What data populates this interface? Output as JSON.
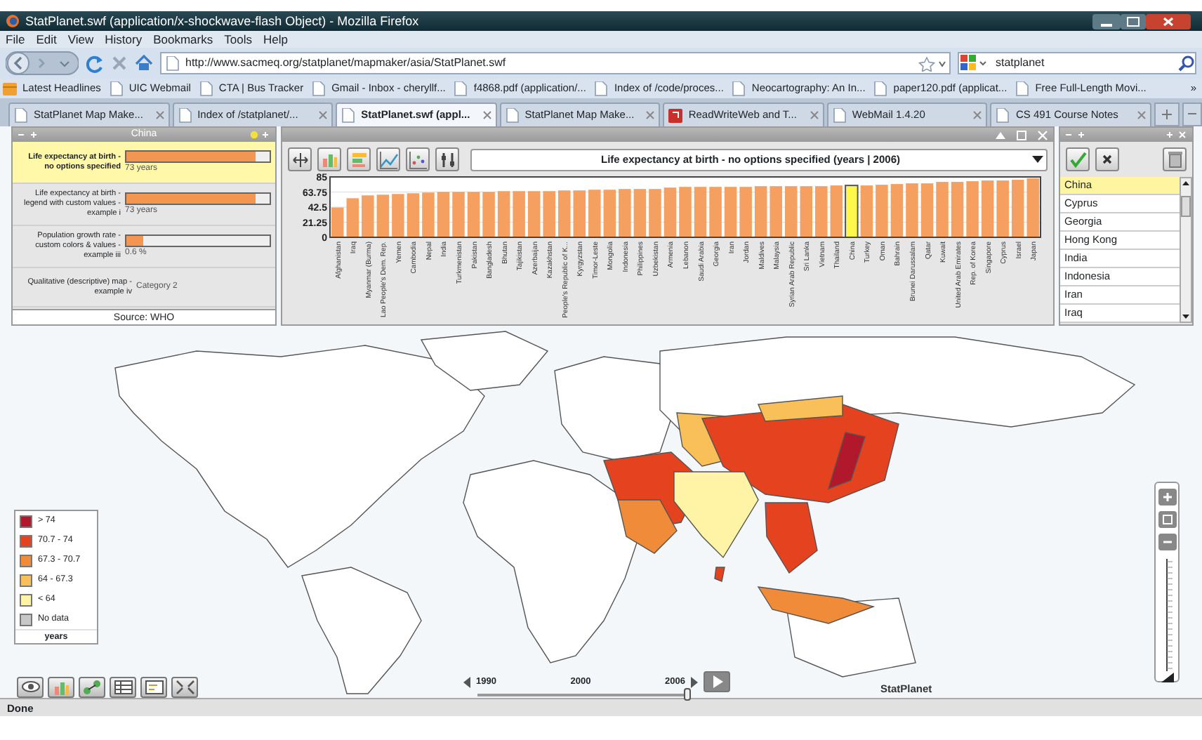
{
  "window": {
    "title": "StatPlanet.swf (application/x-shockwave-flash Object) - Mozilla Firefox"
  },
  "menu": [
    "File",
    "Edit",
    "View",
    "History",
    "Bookmarks",
    "Tools",
    "Help"
  ],
  "address_bar": {
    "url": "http://www.sacmeq.org/statplanet/mapmaker/asia/StatPlanet.swf"
  },
  "search": {
    "value": "statplanet"
  },
  "bookmarks": [
    {
      "label": "Latest Headlines",
      "kind": "feed"
    },
    {
      "label": "UIC Webmail",
      "kind": "page"
    },
    {
      "label": "CTA | Bus Tracker",
      "kind": "page"
    },
    {
      "label": "Gmail - Inbox - cheryllf...",
      "kind": "page"
    },
    {
      "label": "f4868.pdf (application/...",
      "kind": "page"
    },
    {
      "label": "Index of /code/proces...",
      "kind": "page"
    },
    {
      "label": "Neocartography: An In...",
      "kind": "page"
    },
    {
      "label": "paper120.pdf (applicat...",
      "kind": "page"
    },
    {
      "label": "Free Full-Length Movi...",
      "kind": "page"
    },
    {
      "label": "»",
      "kind": "more"
    }
  ],
  "tabs": [
    {
      "label": "StatPlanet Map Make...",
      "selected": false,
      "kind": "page"
    },
    {
      "label": "Index of /statplanet/...",
      "selected": false,
      "kind": "page"
    },
    {
      "label": "StatPlanet.swf (appl...",
      "selected": true,
      "kind": "page"
    },
    {
      "label": "StatPlanet Map Make...",
      "selected": false,
      "kind": "page"
    },
    {
      "label": "ReadWriteWeb and T...",
      "selected": false,
      "kind": "site"
    },
    {
      "label": "WebMail 1.4.20",
      "selected": false,
      "kind": "page"
    },
    {
      "label": "CS 491 Course Notes",
      "selected": false,
      "kind": "page"
    }
  ],
  "indicator_panel": {
    "title": "China",
    "items": [
      {
        "label": "Life expectancy at birth - no options specified",
        "value": "73 years",
        "kind": "bar",
        "level": 0.9,
        "selected": true
      },
      {
        "label": "Life expectancy at birth - legend with custom values - example i",
        "value": "73 years",
        "kind": "bar",
        "level": 0.9,
        "selected": false
      },
      {
        "label": "Population growth rate - custom colors & values - example iii",
        "value": "0.6 %",
        "kind": "bar",
        "level": 0.12,
        "selected": false
      },
      {
        "label": "Qualitative (descriptive) map - example iv",
        "value": "Category 2",
        "kind": "text",
        "selected": false
      }
    ],
    "source": "Source: WHO"
  },
  "chart_panel": {
    "title": "Life expectancy at birth - no options specified (years | 2006)",
    "chart_data": {
      "type": "bar",
      "grid": true,
      "ylim": [
        0,
        85
      ],
      "yticks": [
        0,
        21.25,
        42.5,
        63.75,
        85
      ],
      "categories": [
        "Afghanistan",
        "Iraq",
        "Myanmar (Burma)",
        "Lao People's Dem. Rep.",
        "Yemen",
        "Cambodia",
        "Nepal",
        "India",
        "Turkmenistan",
        "Pakistan",
        "Bangladesh",
        "Bhutan",
        "Tajikistan",
        "Azerbaijan",
        "Kazakhstan",
        "People's Republic of K...",
        "Kyrgyzstan",
        "Timor-Leste",
        "Mongolia",
        "Indonesia",
        "Philippines",
        "Uzbekistan",
        "Armenia",
        "Lebanon",
        "Saudi Arabia",
        "Georgia",
        "Iran",
        "Jordan",
        "Maldives",
        "Malaysia",
        "Syrian Arab Republic",
        "Sri Lanka",
        "Vietnam",
        "Thailand",
        "China",
        "Turkey",
        "Oman",
        "Bahrain",
        "Brunei Darussalam",
        "Qatar",
        "Kuwait",
        "United Arab Emirates",
        "Rep. of Korea",
        "Singapore",
        "Cyprus",
        "Israel",
        "Japan"
      ],
      "values": [
        42,
        55,
        59,
        60,
        61,
        62,
        63,
        64,
        64,
        64,
        64,
        65,
        65,
        65,
        65,
        66,
        66,
        67,
        67,
        68,
        68,
        68,
        70,
        71,
        71,
        71,
        71,
        71,
        72,
        72,
        72,
        72,
        72,
        73,
        73,
        73,
        74,
        75,
        76,
        76,
        78,
        78,
        79,
        80,
        80,
        81,
        83
      ]
    }
  },
  "country_list": {
    "items": [
      {
        "label": "China",
        "selected": true
      },
      {
        "label": "Cyprus",
        "selected": false
      },
      {
        "label": "Georgia",
        "selected": false
      },
      {
        "label": "Hong Kong",
        "selected": false
      },
      {
        "label": "India",
        "selected": false
      },
      {
        "label": "Indonesia",
        "selected": false
      },
      {
        "label": "Iran",
        "selected": false
      },
      {
        "label": "Iraq",
        "selected": false
      }
    ]
  },
  "legend": {
    "items": [
      {
        "label": "> 74",
        "color": "#b2182b"
      },
      {
        "label": "70.7 - 74",
        "color": "#e5421f"
      },
      {
        "label": "67.3 - 70.7",
        "color": "#f08b3a"
      },
      {
        "label": "64 - 67.3",
        "color": "#f9c05a"
      },
      {
        "label": "< 64",
        "color": "#fff3a6"
      },
      {
        "label": "No data",
        "color": "#c8c8c8"
      }
    ],
    "unit": "years"
  },
  "timeline": {
    "labels": [
      "1990",
      "2000",
      "2006"
    ],
    "level": 1.0
  },
  "map_brand": "StatPlanet",
  "zoom_control": {
    "level": 0.0
  },
  "status_bar": "Done"
}
